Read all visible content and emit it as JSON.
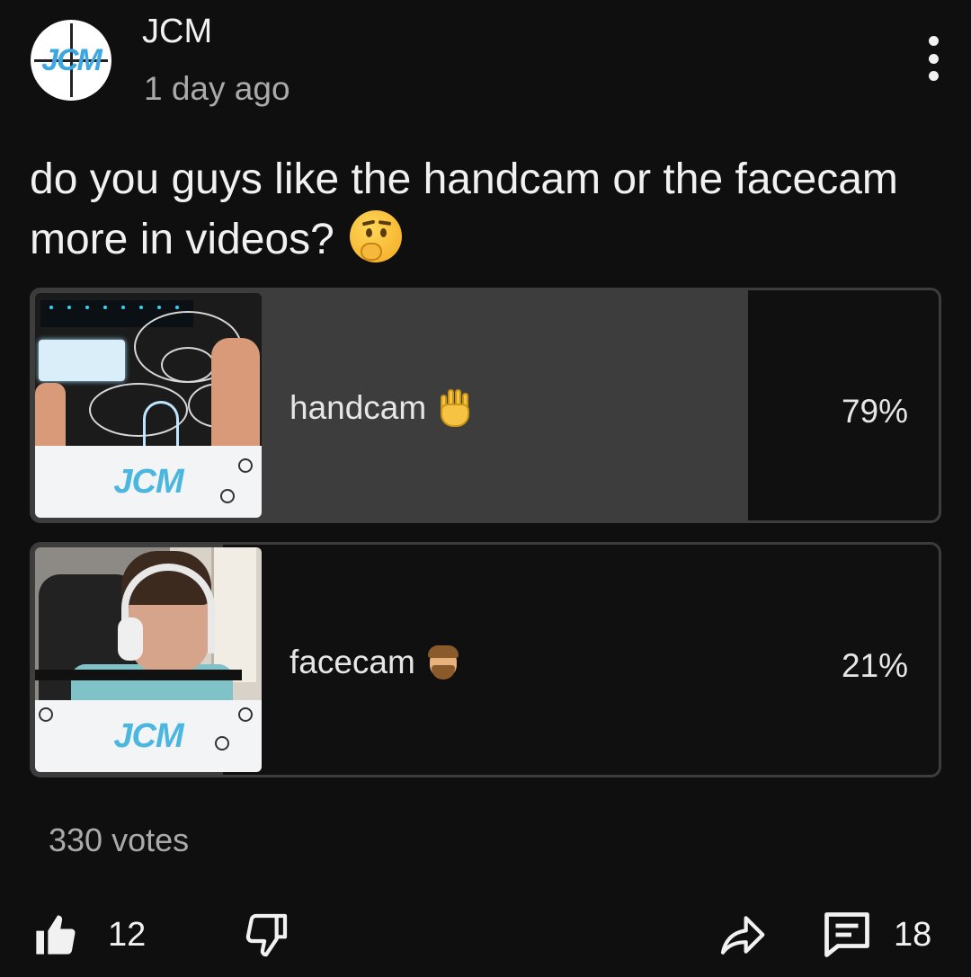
{
  "header": {
    "channel_name": "JCM",
    "avatar_logo": "JCM",
    "time": "1 day ago"
  },
  "post": {
    "text": "do you guys like the handcam or the facecam more in videos?",
    "emoji": "thinking-face"
  },
  "poll": {
    "options": [
      {
        "label": "handcam",
        "emoji": "raised-hand",
        "percent_text": "79%",
        "percent": 79,
        "thumb_logo": "JCM"
      },
      {
        "label": "facecam",
        "emoji": "bearded-person",
        "percent_text": "21%",
        "percent": 21,
        "thumb_logo": "JCM"
      }
    ],
    "votes": "330 votes"
  },
  "actions": {
    "like_count": "12",
    "comment_count": "18",
    "icons": [
      "thumbs-up-icon",
      "thumbs-down-icon",
      "share-icon",
      "comment-icon"
    ]
  },
  "colors": {
    "background": "#0f0f0f",
    "option_fill": "#3d3d3d",
    "text_primary": "#f1f1f1",
    "text_secondary": "#aaaaaa"
  }
}
